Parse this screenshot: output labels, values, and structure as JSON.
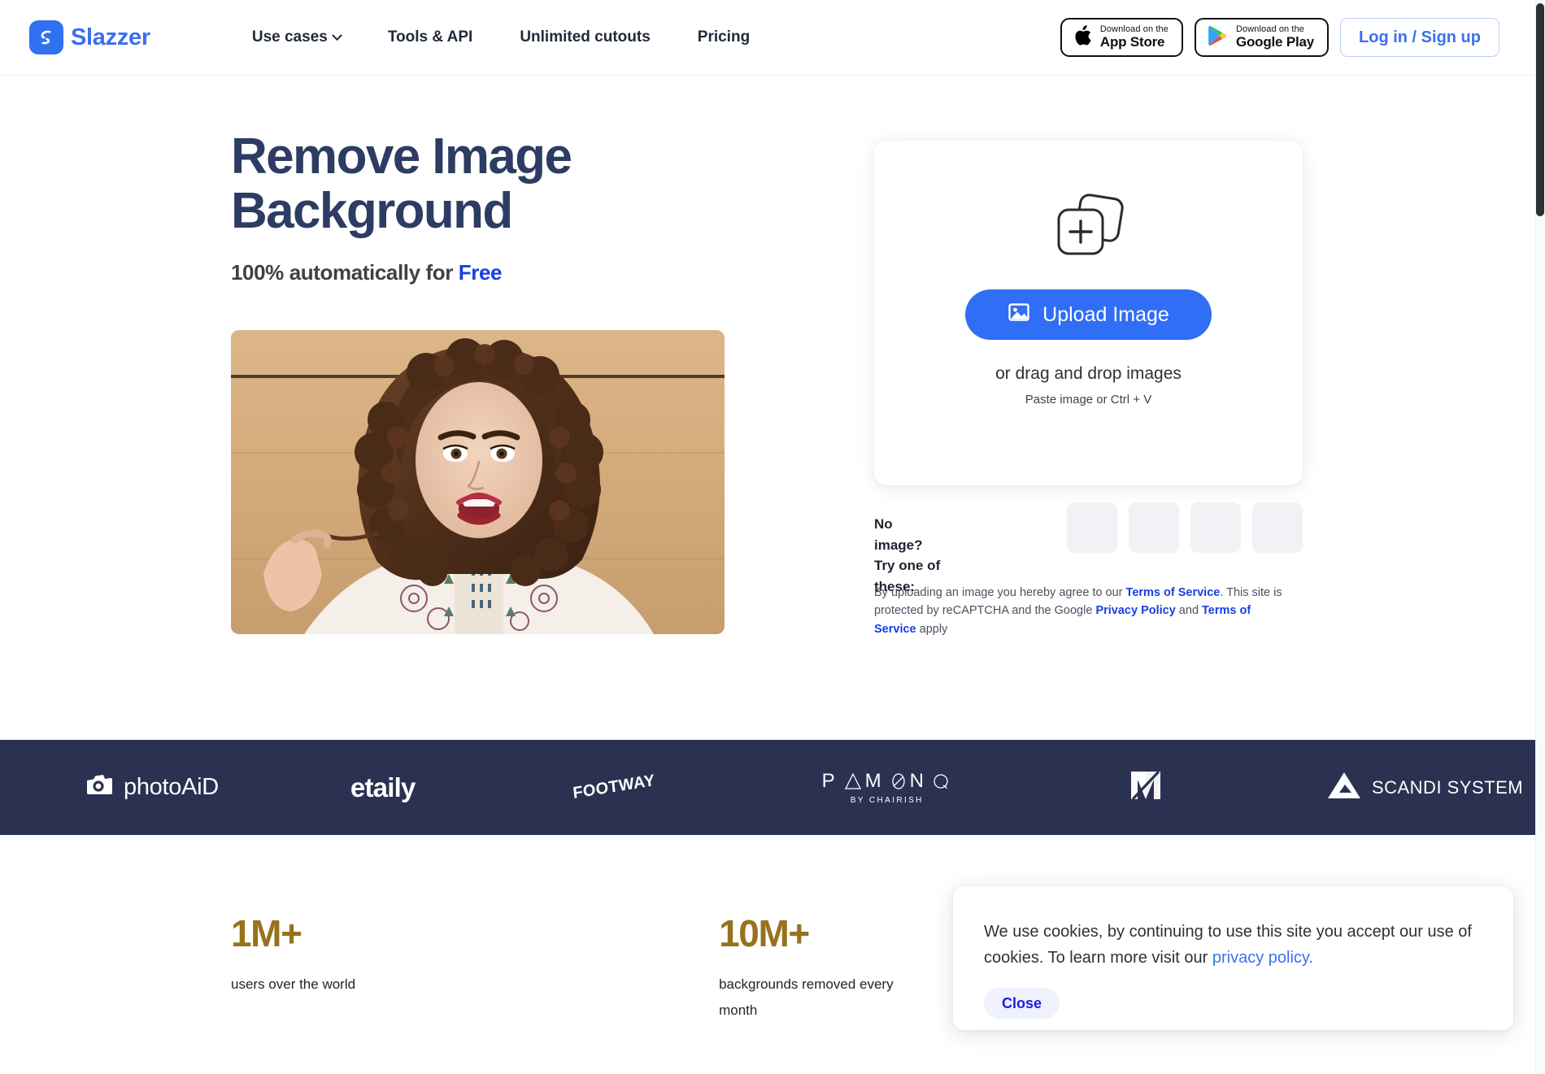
{
  "header": {
    "logo": {
      "icon": "slazzer-logo-icon",
      "text": "Slazzer"
    },
    "nav": [
      {
        "label": "Use cases",
        "has_chevron": true
      },
      {
        "label": "Tools & API",
        "has_chevron": false
      },
      {
        "label": "Unlimited cutouts",
        "has_chevron": false
      },
      {
        "label": "Pricing",
        "has_chevron": false
      }
    ],
    "app_store": {
      "small": "Download on the",
      "large": "App Store",
      "icon": "apple-icon"
    },
    "google_play": {
      "small": "Download on the",
      "large": "Google Play",
      "icon": "google-play-icon"
    },
    "login": "Log in / Sign up"
  },
  "hero": {
    "title_line1": "Remove Image",
    "title_line2": "Background",
    "subtitle_prefix": "100% automatically for ",
    "subtitle_highlight": "Free",
    "photo_alt": "woman-with-curly-hair-photo"
  },
  "upload": {
    "stack_icon": "add-images-icon",
    "button_label": "Upload Image",
    "button_icon": "image-icon",
    "drag_text": "or drag and drop images",
    "paste_text": "Paste image or Ctrl + V",
    "accent_color": "#2f6ef5"
  },
  "samples": {
    "label_line1": "No image?",
    "label_line2": "Try one of these:",
    "thumbs": [
      "sample-1",
      "sample-2",
      "sample-3",
      "sample-4"
    ]
  },
  "legal": {
    "p1": "By uploading an image you hereby agree to our ",
    "tos1": "Terms of Service",
    "p2": ". This site is protected by reCAPTCHA and the Google ",
    "privacy": "Privacy Policy",
    "p3": " and ",
    "tos2": "Terms of Service",
    "p4": " apply"
  },
  "brands": {
    "background": "#2b3151",
    "items": [
      {
        "name": "photoAiD",
        "icon": "camera-icon"
      },
      {
        "name": "etaily",
        "icon": ""
      },
      {
        "name": "FOOTWAY",
        "icon": ""
      },
      {
        "name": "PAMONO",
        "sub": "BY CHAIRISH",
        "icon": ""
      },
      {
        "name": "vabbr-mark",
        "icon": "monogram-icon"
      },
      {
        "name": "SCANDI SYSTEM",
        "icon": "triangle-icon"
      }
    ]
  },
  "stats": [
    {
      "number": "1M+",
      "label": "users over the world"
    },
    {
      "number": "10M+",
      "label": "backgrounds removed every month"
    }
  ],
  "cookie": {
    "text_part1": "We use cookies, by continuing to use this site you accept our use of cookies.  To learn more visit our ",
    "link": "privacy policy.",
    "close_label": "Close"
  },
  "scrollbar": {
    "orientation": "vertical"
  }
}
